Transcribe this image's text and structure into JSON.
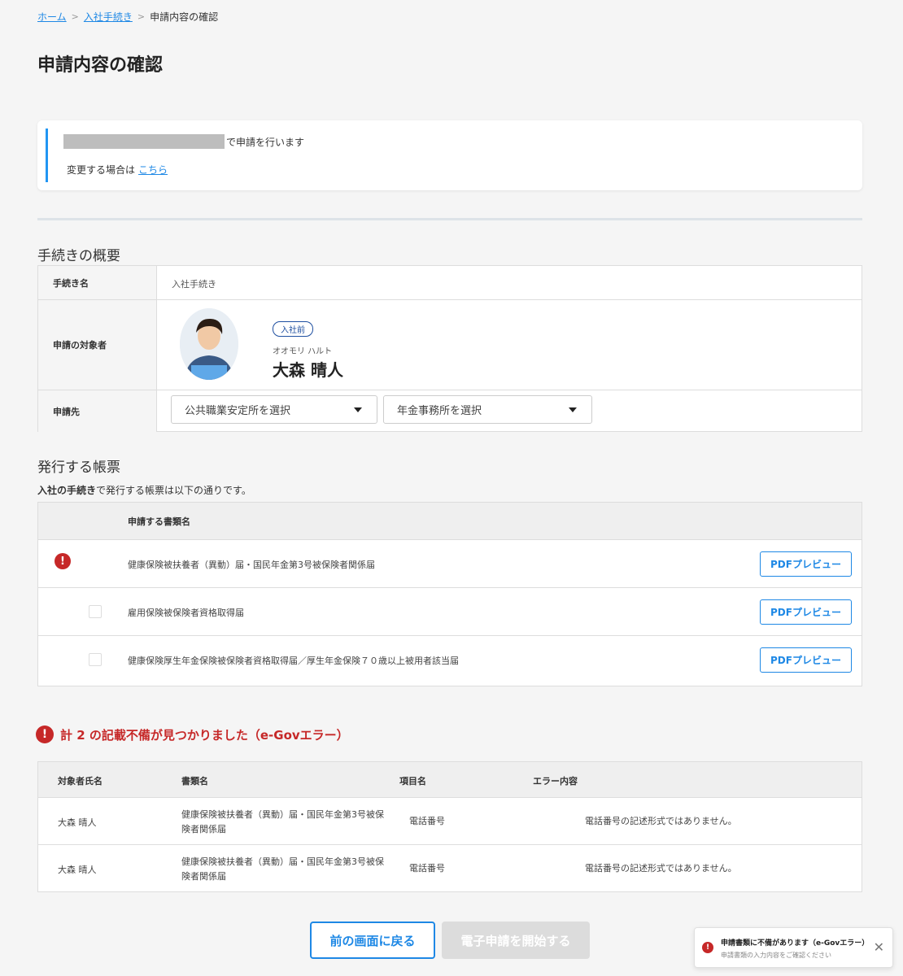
{
  "breadcrumb": {
    "home": "ホーム",
    "procedure": "入社手続き",
    "current": "申請内容の確認"
  },
  "page_title": "申請内容の確認",
  "notice": {
    "line1": "で申請を行います",
    "line2": "変更する場合は",
    "link": "こちら"
  },
  "overview": {
    "title": "手続きの概要",
    "rows": {
      "procedure_label": "手続き名",
      "procedure_value": "入社手続き",
      "target_label": "申請の対象者",
      "badge": "入社前",
      "kana": "オオモリ ハルト",
      "name": "大森 晴人",
      "dest_label": "申請先",
      "select1": "公共職業安定所を選択",
      "select2": "年金事務所を選択"
    }
  },
  "forms": {
    "title": "発行する帳票",
    "desc_bold": "入社の手続き",
    "desc_rest": "で発行する帳票は以下の通りです。",
    "column": "申請する書類名",
    "pdf_label": "PDFプレビュー",
    "items": [
      {
        "name": "健康保険被扶養者（異動）届・国民年金第3号被保険者関係届",
        "status": "error"
      },
      {
        "name": "雇用保険被保険者資格取得届",
        "status": "checkbox"
      },
      {
        "name": "健康保険厚生年金保険被保険者資格取得届／厚生年金保険７０歳以上被用者該当届",
        "status": "checkbox"
      }
    ]
  },
  "errors": {
    "title": "計 2 の記載不備が見つかりました（e-Govエラー）",
    "columns": {
      "person": "対象者氏名",
      "doc": "書類名",
      "item": "項目名",
      "content": "エラー内容"
    },
    "rows": [
      {
        "person": "大森 晴人",
        "doc": "健康保険被扶養者（異動）届・国民年金第3号被保険者関係届",
        "item": "電話番号",
        "content": "電話番号の記述形式ではありません。"
      },
      {
        "person": "大森 晴人",
        "doc": "健康保険被扶養者（異動）届・国民年金第3号被保険者関係届",
        "item": "電話番号",
        "content": "電話番号の記述形式ではありません。"
      }
    ]
  },
  "actions": {
    "back": "前の画面に戻る",
    "submit": "電子申請を開始する"
  },
  "toast": {
    "title": "申請書類に不備があります（e-Govエラー）",
    "message": "申請書類の入力内容をご確認ください"
  },
  "colors": {
    "accent": "#1e88e5",
    "error": "#c62828",
    "notice_bar": "#2196f3"
  }
}
